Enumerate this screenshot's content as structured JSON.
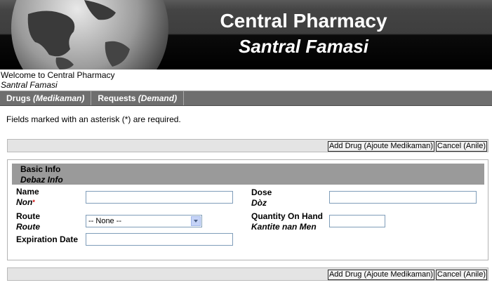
{
  "header": {
    "title": "Central Pharmacy",
    "subtitle": "Santral Famasi"
  },
  "welcome": {
    "line1": "Welcome to Central Pharmacy",
    "line2": "Santral Famasi"
  },
  "nav": [
    {
      "label": "Drugs",
      "label_alt": "(Medikaman)"
    },
    {
      "label": "Requests",
      "label_alt": "(Demand)"
    }
  ],
  "required_note": "Fields marked with an asterisk (*) are required.",
  "buttons": {
    "add": "Add Drug (Ajoute Medikaman)",
    "cancel": "Cancel (Anile)"
  },
  "section": {
    "title": "Basic Info",
    "title_alt": "Debaz Info"
  },
  "fields": {
    "name": {
      "label": "Name",
      "label_alt": "Non",
      "required_mark": "*",
      "value": ""
    },
    "dose": {
      "label": "Dose",
      "label_alt": "Dòz",
      "value": ""
    },
    "route": {
      "label": "Route",
      "label_alt": "Route",
      "selected": "-- None --"
    },
    "quantity": {
      "label": "Quantity On Hand",
      "label_alt": "Kantite nan Men",
      "value": ""
    },
    "expiration": {
      "label": "Expiration Date",
      "value": ""
    }
  }
}
